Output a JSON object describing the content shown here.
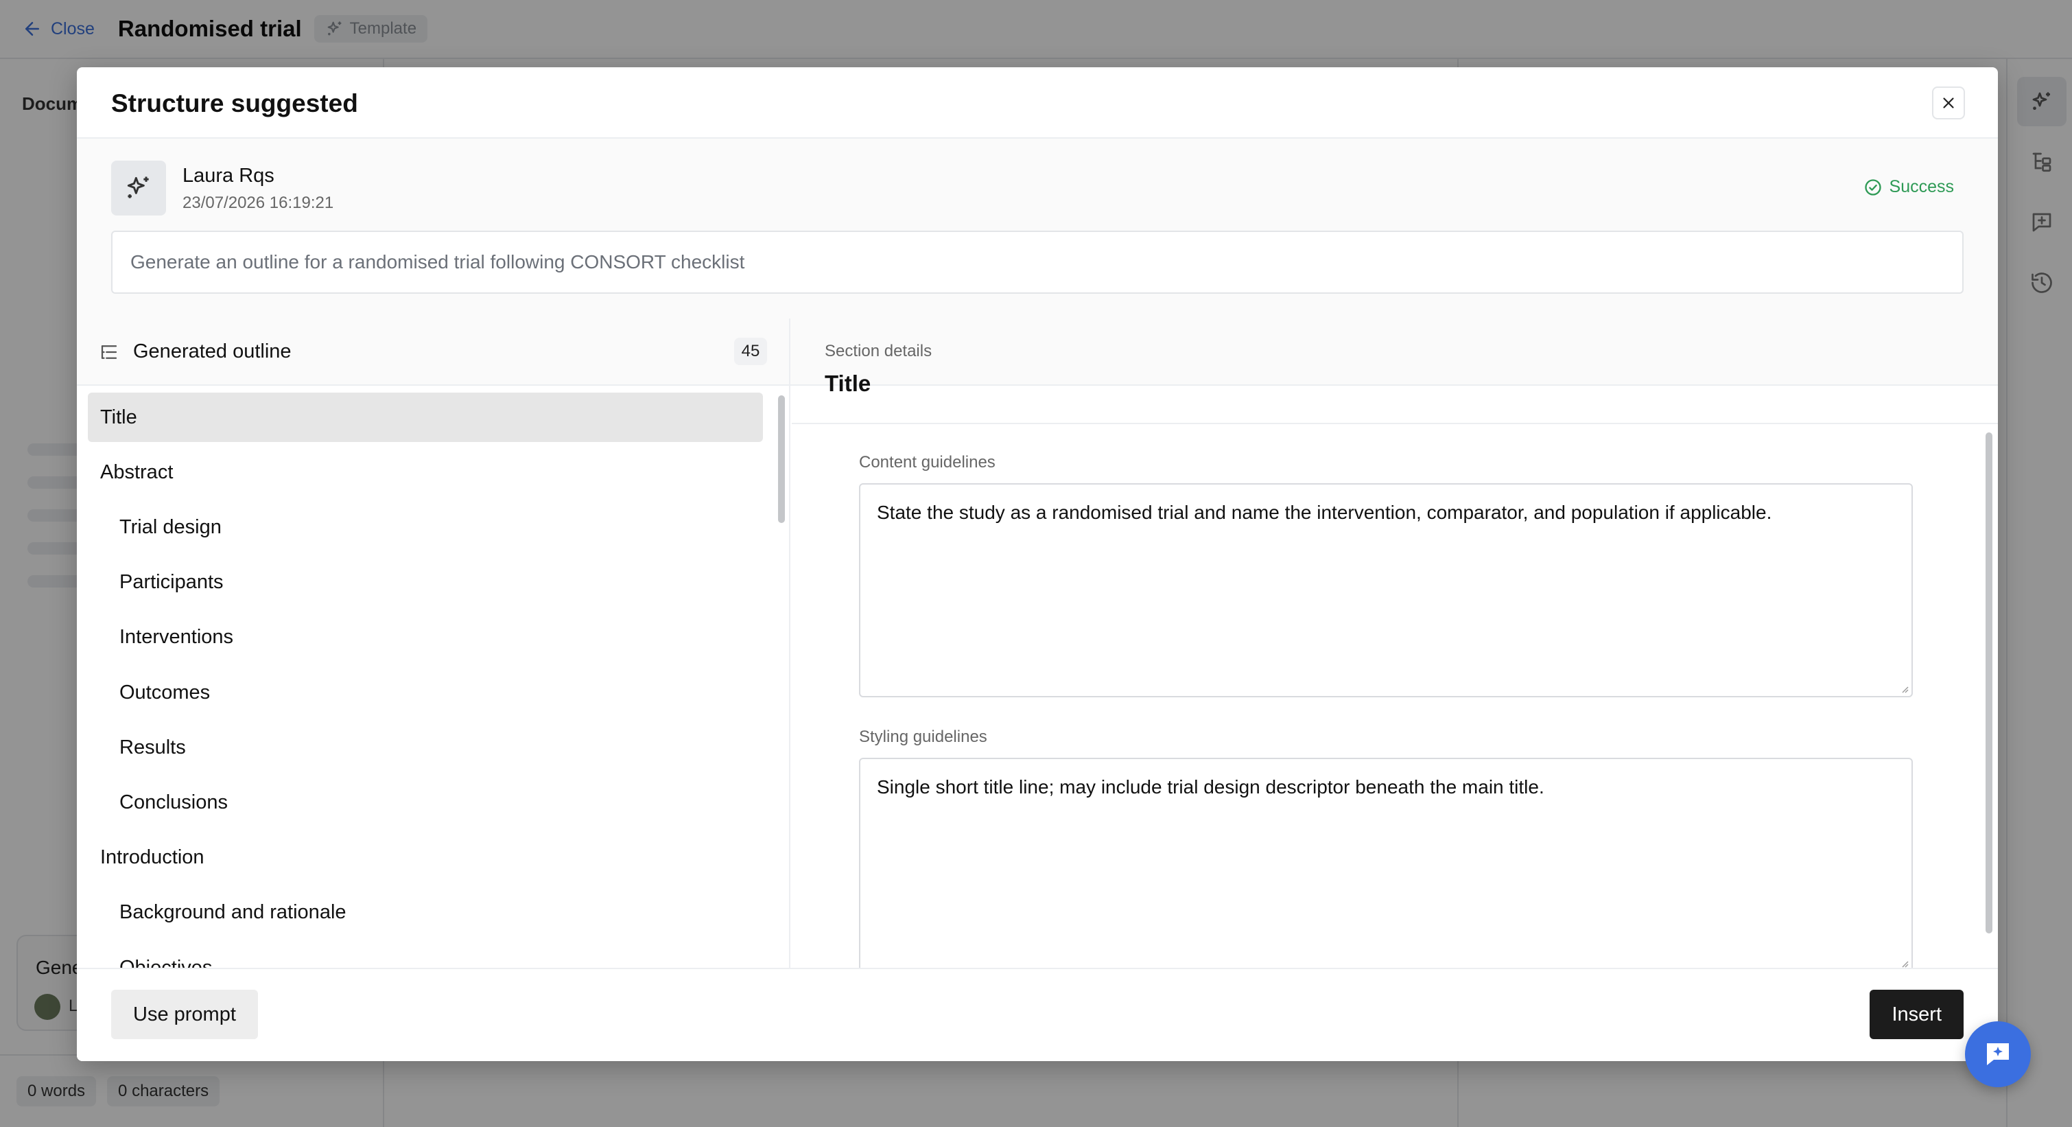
{
  "topbar": {
    "close_label": "Close",
    "doc_title": "Randomised trial",
    "template_label": "Template"
  },
  "left_panel": {
    "doc_label": "Docum",
    "gen_card_title": "Gene",
    "gen_card_name": "L",
    "words": "0 words",
    "characters": "0 characters"
  },
  "modal": {
    "title": "Structure suggested",
    "author": {
      "name": "Laura Rqs",
      "date": "23/07/2026 16:19:21"
    },
    "status": "Success",
    "prompt": "Generate an outline for a randomised trial following CONSORT checklist",
    "outline": {
      "title": "Generated outline",
      "count": "45",
      "items": [
        {
          "label": "Title",
          "level": 0,
          "selected": true
        },
        {
          "label": "Abstract",
          "level": 0,
          "selected": false
        },
        {
          "label": "Trial design",
          "level": 1,
          "selected": false
        },
        {
          "label": "Participants",
          "level": 1,
          "selected": false
        },
        {
          "label": "Interventions",
          "level": 1,
          "selected": false
        },
        {
          "label": "Outcomes",
          "level": 1,
          "selected": false
        },
        {
          "label": "Results",
          "level": 1,
          "selected": false
        },
        {
          "label": "Conclusions",
          "level": 1,
          "selected": false
        },
        {
          "label": "Introduction",
          "level": 0,
          "selected": false
        },
        {
          "label": "Background and rationale",
          "level": 1,
          "selected": false
        },
        {
          "label": "Objectives",
          "level": 1,
          "selected": false
        }
      ]
    },
    "details": {
      "label": "Section details",
      "title": "Title",
      "content_label": "Content guidelines",
      "content_value": "State the study as a randomised trial and name the intervention, comparator, and population if applicable.",
      "styling_label": "Styling guidelines",
      "styling_value": "Single short title line; may include trial design descriptor beneath the main title."
    },
    "footer": {
      "use_prompt": "Use prompt",
      "insert": "Insert"
    }
  },
  "colors": {
    "accent": "#3b6fe0",
    "success": "#2e9a55",
    "primary_button": "#1c1c1c"
  },
  "icons": {
    "close_link": "arrow-left-icon",
    "template": "sparkles-icon",
    "author": "sparkles-icon",
    "status": "check-circle-icon",
    "outline": "list-tree-icon",
    "toolbar": [
      "sparkles-icon",
      "tree-icon",
      "comment-plus-icon",
      "history-icon"
    ],
    "fab": "chat-sparkle-icon"
  }
}
